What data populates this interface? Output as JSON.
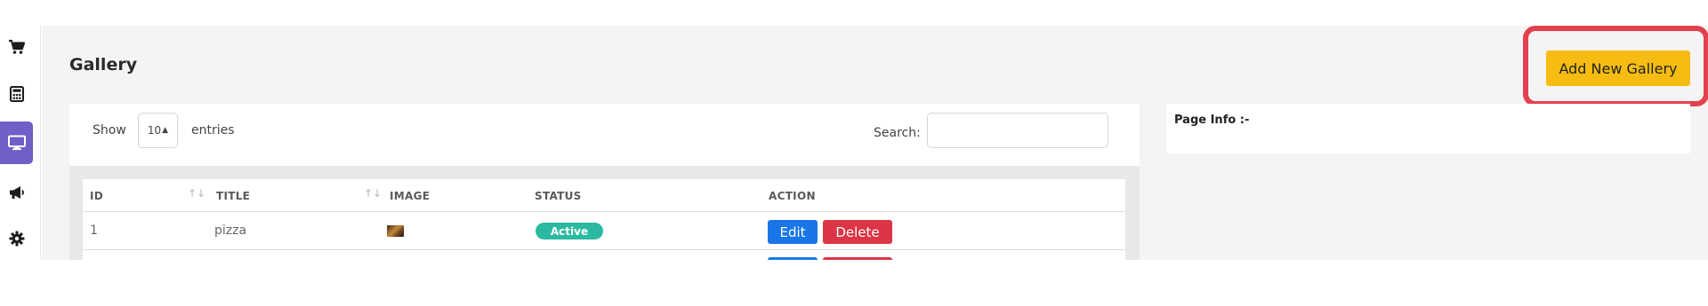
{
  "sidebar": {
    "items": [
      {
        "icon": "cart-icon",
        "active": false
      },
      {
        "icon": "calculator-icon",
        "active": false
      },
      {
        "icon": "monitor-icon",
        "active": true
      },
      {
        "icon": "megaphone-icon",
        "active": false
      },
      {
        "icon": "gear-icon",
        "active": false
      }
    ],
    "active_color": "#6f5fc6"
  },
  "header": {
    "title": "Gallery",
    "add_button_label": "Add New Gallery",
    "add_button_color": "#f6bc12",
    "highlight_color": "#e2414e"
  },
  "table_controls": {
    "show_label": "Show",
    "page_size": "10",
    "entries_label": "entries",
    "search_label": "Search:",
    "search_value": ""
  },
  "table": {
    "columns": [
      "ID",
      "TITLE",
      "IMAGE",
      "STATUS",
      "ACTION"
    ],
    "rows": [
      {
        "id": "1",
        "title": "pizza",
        "image": "pizza-thumbnail",
        "status": "Active",
        "edit_label": "Edit",
        "delete_label": "Delete"
      }
    ]
  },
  "page_info": {
    "title": "Page Info :-"
  }
}
